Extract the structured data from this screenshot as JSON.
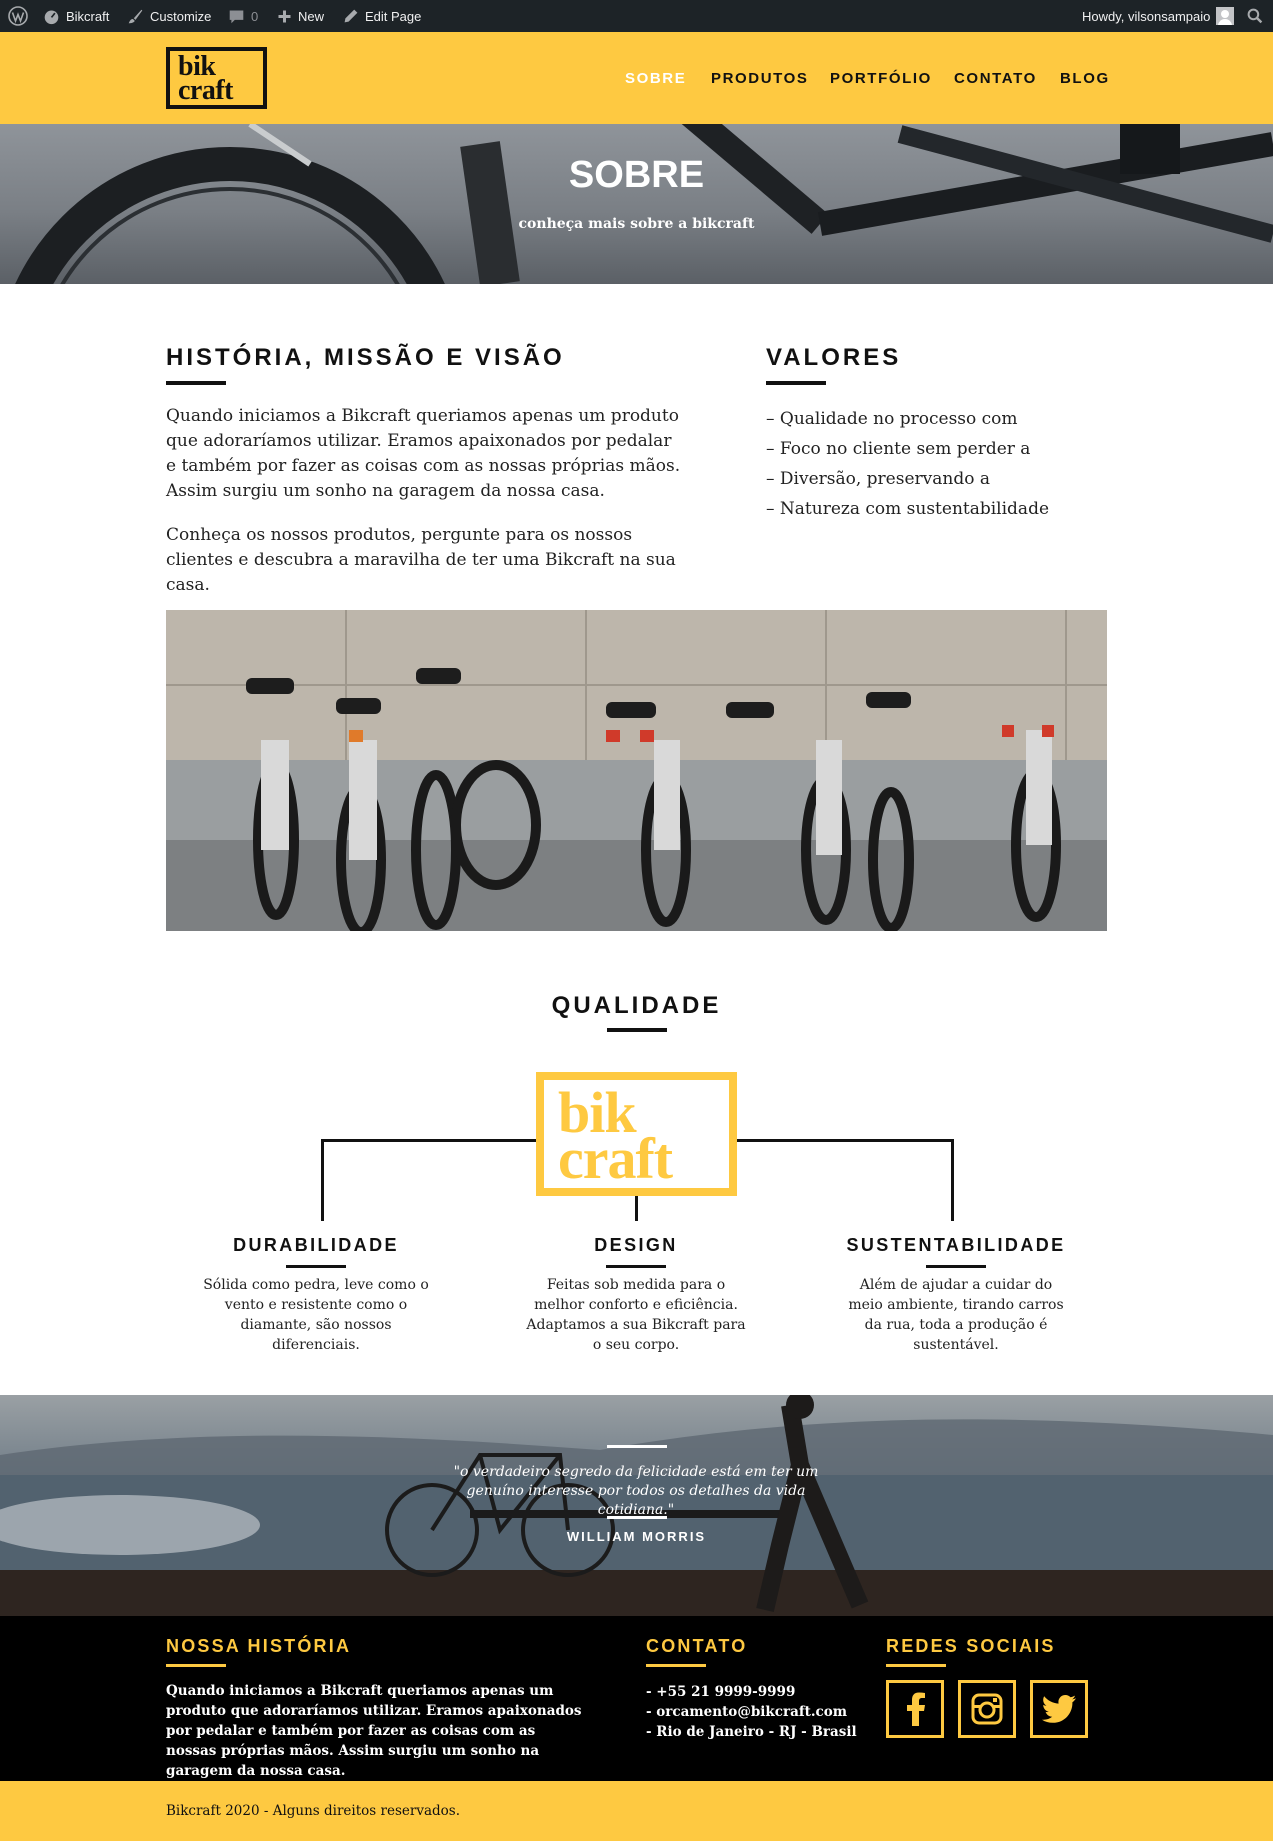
{
  "admin_bar": {
    "site_name": "Bikcraft",
    "customize": "Customize",
    "comments_count": "0",
    "new": "New",
    "edit_page": "Edit Page",
    "howdy": "Howdy, vilsonsampaio"
  },
  "header": {
    "logo_line1": "bik",
    "logo_line2": "craft",
    "nav": [
      "SOBRE",
      "PRODUTOS",
      "PORTFÓLIO",
      "CONTATO",
      "BLOG"
    ],
    "active_nav": "SOBRE"
  },
  "hero": {
    "title": "SOBRE",
    "subtitle": "conheça mais sobre a bikcraft"
  },
  "historia": {
    "title": "HISTÓRIA, MISSÃO E VISÃO",
    "p1": "Quando iniciamos a Bikcraft queriamos apenas um produto que adoraríamos utilizar. Eramos apaixonados por pedalar e também por fazer as coisas com as nossas próprias mãos. Assim surgiu um sonho na garagem da nossa casa.",
    "p2": "Conheça os nossos produtos, pergunte para os nossos clientes e descubra a maravilha de ter uma Bikcraft na sua casa."
  },
  "valores": {
    "title": "VALORES",
    "items": [
      "– Qualidade no processo com",
      "– Foco no cliente sem perder a",
      "– Diversão, preservando a",
      "– Natureza com sustentabilidade"
    ]
  },
  "qualidade": {
    "title": "QUALIDADE",
    "logo_line1": "bik",
    "logo_line2": "craft",
    "features": [
      {
        "title": "DURABILIDADE",
        "text": "Sólida como pedra, leve como o vento e resistente como o diamante, são nossos diferenciais."
      },
      {
        "title": "DESIGN",
        "text": "Feitas sob medida para o melhor conforto e eficiência. Adaptamos a sua Bikcraft para o seu corpo."
      },
      {
        "title": "SUSTENTABILIDADE",
        "text": "Além de ajudar a cuidar do meio ambiente, tirando carros da rua, toda a produção é sustentável."
      }
    ]
  },
  "quote": {
    "text": "\"o verdadeiro segredo da felicidade está em ter um genuíno interesse por todos os detalhes da vida cotidiana.\"",
    "author": "WILLIAM MORRIS"
  },
  "footer": {
    "historia_title": "NOSSA HISTÓRIA",
    "historia_text": "Quando iniciamos a Bikcraft queriamos apenas um produto que adoraríamos utilizar. Eramos apaixonados por pedalar e também por fazer as coisas com as nossas próprias mãos. Assim surgiu um sonho na garagem da nossa casa.",
    "contato_title": "CONTATO",
    "contato_lines": [
      "- +55 21 9999-9999",
      "- orcamento@bikcraft.com",
      "- Rio de Janeiro - RJ - Brasil"
    ],
    "redes_title": "REDES SOCIAIS",
    "social_icons": [
      "facebook-icon",
      "instagram-icon",
      "twitter-icon"
    ],
    "copyright": "Bikcraft 2020 - Alguns direitos reservados."
  },
  "colors": {
    "brand_yellow": "#fec941",
    "dark": "#111111",
    "admin_bar": "#1d2327"
  }
}
